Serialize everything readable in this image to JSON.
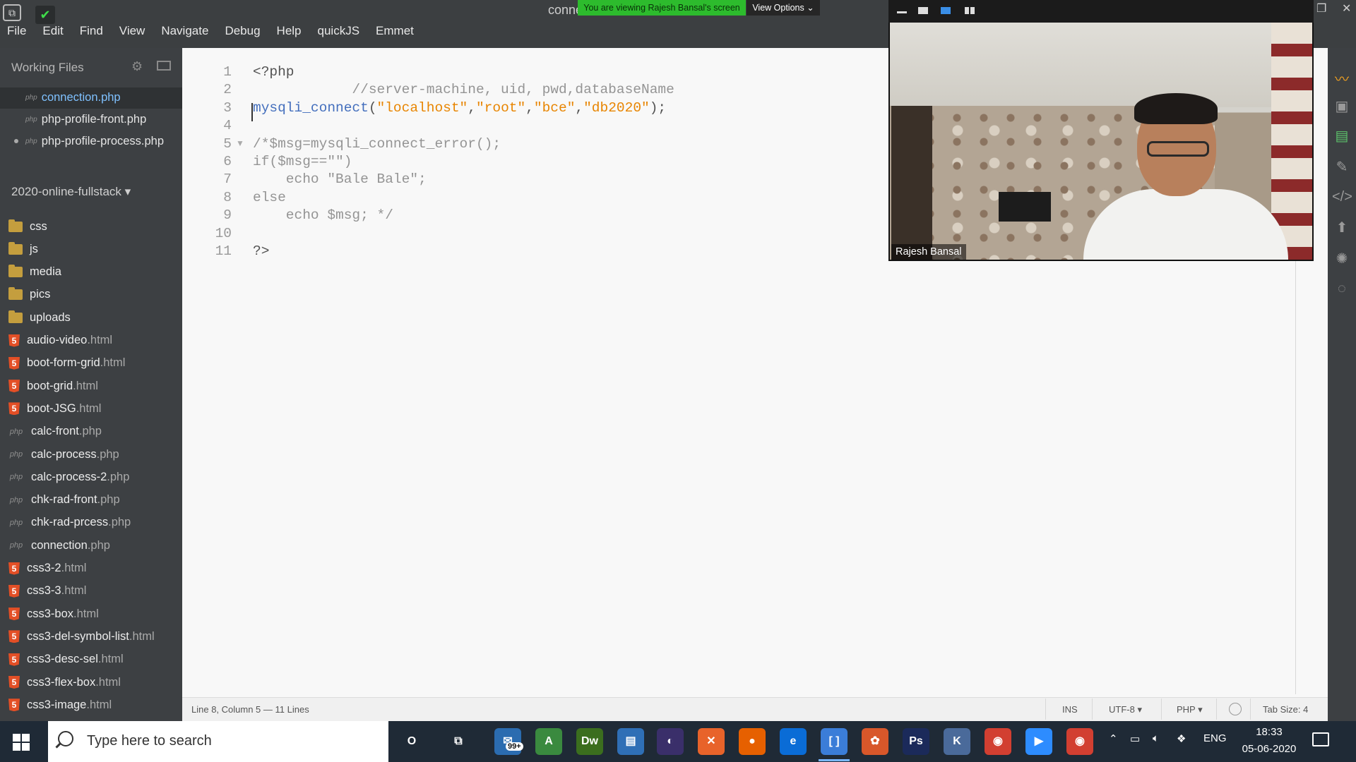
{
  "window": {
    "title": "conne",
    "share_banner": "You are viewing Rajesh Bansal's screen",
    "view_options": "View Options ⌄"
  },
  "menu": [
    "File",
    "Edit",
    "Find",
    "View",
    "Navigate",
    "Debug",
    "Help",
    "quickJS",
    "Emmet"
  ],
  "working_files": {
    "header": "Working Files",
    "items": [
      {
        "tag": "php",
        "name": "connection.php"
      },
      {
        "tag": "php",
        "name": "php-profile-front.php"
      },
      {
        "tag": "php",
        "name": "php-profile-process.php"
      }
    ]
  },
  "project": {
    "name": "2020-online-fullstack ▾",
    "tree": [
      {
        "type": "folder",
        "name": "css",
        "ext": ""
      },
      {
        "type": "folder",
        "name": "js",
        "ext": ""
      },
      {
        "type": "folder",
        "name": "media",
        "ext": ""
      },
      {
        "type": "folder",
        "name": "pics",
        "ext": ""
      },
      {
        "type": "folder",
        "name": "uploads",
        "ext": ""
      },
      {
        "type": "html",
        "name": "audio-video",
        "ext": ".html"
      },
      {
        "type": "html",
        "name": "boot-form-grid",
        "ext": ".html"
      },
      {
        "type": "html",
        "name": "boot-grid",
        "ext": ".html"
      },
      {
        "type": "html",
        "name": "boot-JSG",
        "ext": ".html"
      },
      {
        "type": "php",
        "name": "calc-front",
        "ext": ".php"
      },
      {
        "type": "php",
        "name": "calc-process",
        "ext": ".php"
      },
      {
        "type": "php",
        "name": "calc-process-2",
        "ext": ".php"
      },
      {
        "type": "php",
        "name": "chk-rad-front",
        "ext": ".php"
      },
      {
        "type": "php",
        "name": "chk-rad-prcess",
        "ext": ".php"
      },
      {
        "type": "php",
        "name": "connection",
        "ext": ".php"
      },
      {
        "type": "html",
        "name": "css3-2",
        "ext": ".html"
      },
      {
        "type": "html",
        "name": "css3-3",
        "ext": ".html"
      },
      {
        "type": "html",
        "name": "css3-box",
        "ext": ".html"
      },
      {
        "type": "html",
        "name": "css3-del-symbol-list",
        "ext": ".html"
      },
      {
        "type": "html",
        "name": "css3-desc-sel",
        "ext": ".html"
      },
      {
        "type": "html",
        "name": "css3-flex-box",
        "ext": ".html"
      },
      {
        "type": "html",
        "name": "css3-image",
        "ext": ".html"
      }
    ]
  },
  "editor": {
    "lines": [
      {
        "n": "1",
        "tokens": [
          {
            "c": "plain",
            "t": "<?php"
          }
        ]
      },
      {
        "n": "2",
        "tokens": [
          {
            "c": "cmt",
            "t": "            //server-machine, uid, pwd,databaseName"
          }
        ]
      },
      {
        "n": "3",
        "tokens": [
          {
            "c": "fn",
            "t": "mysqli_connect"
          },
          {
            "c": "plain",
            "t": "("
          },
          {
            "c": "str",
            "t": "\"localhost\""
          },
          {
            "c": "plain",
            "t": ","
          },
          {
            "c": "str",
            "t": "\"root\""
          },
          {
            "c": "plain",
            "t": ","
          },
          {
            "c": "str",
            "t": "\"bce\""
          },
          {
            "c": "plain",
            "t": ","
          },
          {
            "c": "str",
            "t": "\"db2020\""
          },
          {
            "c": "plain",
            "t": ");"
          }
        ]
      },
      {
        "n": "4",
        "tokens": []
      },
      {
        "n": "5",
        "tokens": [
          {
            "c": "cmt",
            "t": "/*$msg=mysqli_connect_error();"
          }
        ]
      },
      {
        "n": "6",
        "tokens": [
          {
            "c": "cmt",
            "t": "if($msg==\"\")"
          }
        ]
      },
      {
        "n": "7",
        "tokens": [
          {
            "c": "cmt",
            "t": "    echo \"Bale Bale\";"
          }
        ]
      },
      {
        "n": "8",
        "tokens": [
          {
            "c": "cmt",
            "t": "else"
          }
        ]
      },
      {
        "n": "9",
        "tokens": [
          {
            "c": "cmt",
            "t": "    echo $msg; */"
          }
        ]
      },
      {
        "n": "10",
        "tokens": []
      },
      {
        "n": "11",
        "tokens": [
          {
            "c": "plain",
            "t": "?>"
          }
        ]
      }
    ]
  },
  "status": {
    "position": "Line 8, Column 5 — 11 Lines",
    "mode": "INS",
    "encoding": "UTF-8 ▾",
    "language": "PHP ▾",
    "tab_size": "Tab Size: 4"
  },
  "video": {
    "participant_name": "Rajesh Bansal"
  },
  "taskbar": {
    "search_placeholder": "Type here to search",
    "badge": "99+",
    "tray_lang": "ENG",
    "time": "18:33",
    "date": "05-06-2020",
    "apps": [
      {
        "icon": "cortana-icon",
        "label": "O",
        "color": "#1f2a36"
      },
      {
        "icon": "task-view-icon",
        "label": "⧉",
        "color": "#1f2a36"
      },
      {
        "icon": "mail-icon",
        "label": "✉",
        "color": "#2b6cb0"
      },
      {
        "icon": "android-studio-icon",
        "label": "A",
        "color": "#3a8a3f"
      },
      {
        "icon": "dreamweaver-icon",
        "label": "Dw",
        "color": "#3b6e1e"
      },
      {
        "icon": "files-icon",
        "label": "▤",
        "color": "#2f6fb6"
      },
      {
        "icon": "eclipse-icon",
        "label": "◐",
        "color": "#3a2f6a"
      },
      {
        "icon": "xampp-icon",
        "label": "✕",
        "color": "#e8632a"
      },
      {
        "icon": "firefox-icon",
        "label": "●",
        "color": "#e66000"
      },
      {
        "icon": "edge-icon",
        "label": "e",
        "color": "#0a6cd6"
      },
      {
        "icon": "brackets-icon",
        "label": "[ ]",
        "color": "#3b7dd8"
      },
      {
        "icon": "paint-icon",
        "label": "✿",
        "color": "#d8572a"
      },
      {
        "icon": "photoshop-icon",
        "label": "Ps",
        "color": "#1b2a5a"
      },
      {
        "icon": "keyboard-icon",
        "label": "K",
        "color": "#4a6a9a"
      },
      {
        "icon": "chrome-icon",
        "label": "◉",
        "color": "#d23f31"
      },
      {
        "icon": "zoom-icon",
        "label": "▶",
        "color": "#2d8cff"
      },
      {
        "icon": "chrome-icon-2",
        "label": "◉",
        "color": "#d23f31"
      }
    ]
  },
  "colors": {
    "chrome_dark": "#3c3f41",
    "sidebar_bg": "#3d4043",
    "share_green": "#2dbb2d",
    "fn_blue": "#446fbd",
    "string_orange": "#e88501",
    "comment_gray": "#949494"
  }
}
